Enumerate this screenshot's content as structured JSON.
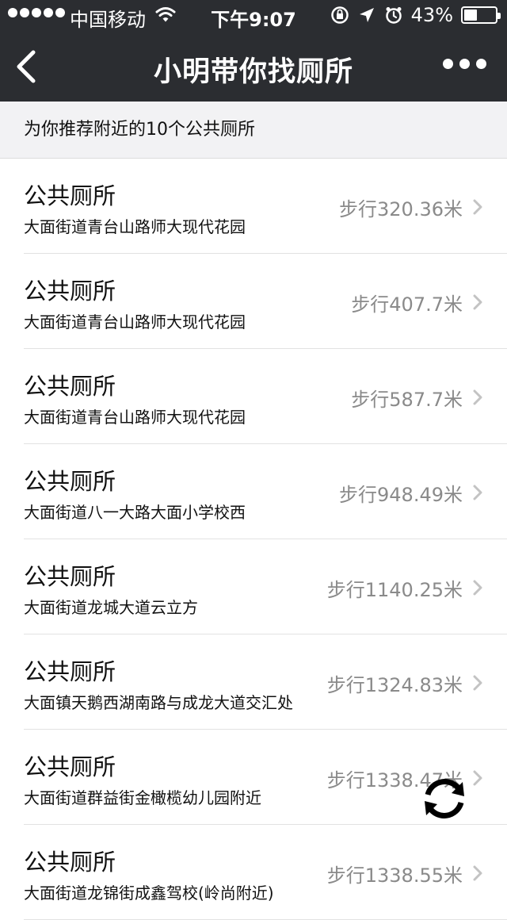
{
  "status_bar": {
    "carrier": "中国移动",
    "time": "下午9:07",
    "battery_percent": "43%",
    "battery_level": 0.43
  },
  "nav": {
    "title": "小明带你找厕所"
  },
  "subheader": "为你推荐附近的10个公共厕所",
  "toilets": [
    {
      "name": "公共厕所",
      "address": "大面街道青台山路师大现代花园",
      "distance": "步行320.36米"
    },
    {
      "name": "公共厕所",
      "address": "大面街道青台山路师大现代花园",
      "distance": "步行407.7米"
    },
    {
      "name": "公共厕所",
      "address": "大面街道青台山路师大现代花园",
      "distance": "步行587.7米"
    },
    {
      "name": "公共厕所",
      "address": "大面街道八一大路大面小学校西",
      "distance": "步行948.49米"
    },
    {
      "name": "公共厕所",
      "address": "大面街道龙城大道云立方",
      "distance": "步行1140.25米"
    },
    {
      "name": "公共厕所",
      "address": "大面镇天鹅西湖南路与成龙大道交汇处",
      "distance": "步行1324.83米"
    },
    {
      "name": "公共厕所",
      "address": "大面街道群益街金橄榄幼儿园附近",
      "distance": "步行1338.47米"
    },
    {
      "name": "公共厕所",
      "address": "大面街道龙锦街成鑫驾校(岭尚附近)",
      "distance": "步行1338.55米"
    }
  ],
  "icons": {
    "back": "back-arrow-icon",
    "more": "more-icon",
    "chevron": "chevron-right-icon",
    "refresh": "refresh-icon"
  }
}
